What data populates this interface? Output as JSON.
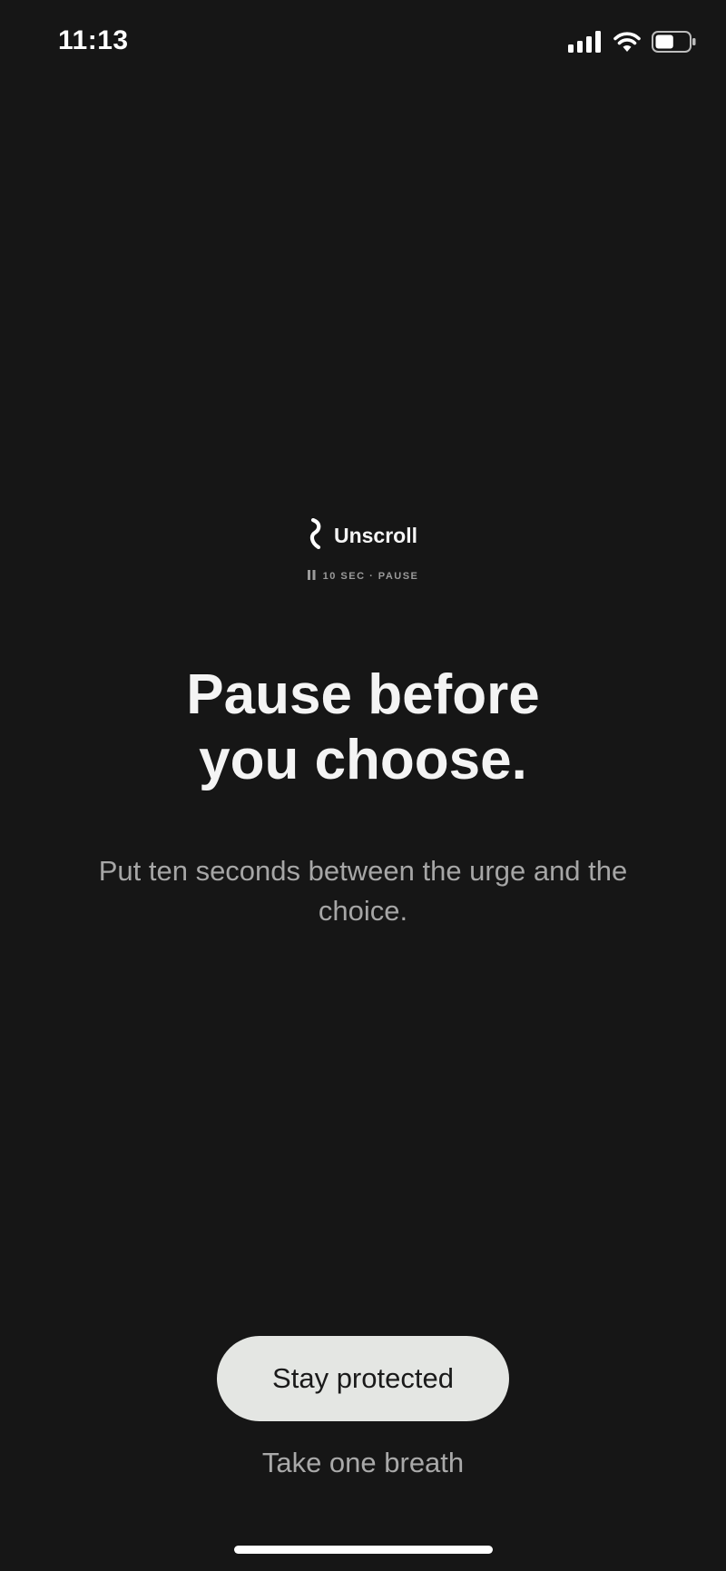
{
  "status_bar": {
    "time": "11:13",
    "icons": [
      "cellular-signal-icon",
      "wifi-icon",
      "battery-icon"
    ],
    "battery_level": 0.55
  },
  "brand": {
    "name": "Unscroll",
    "logo_icon": "unscroll-logo-icon"
  },
  "mode": {
    "icon": "pause-icon",
    "label": "10 SEC · PAUSE"
  },
  "headline": {
    "line1": "Pause before",
    "line2": "you choose."
  },
  "subtext": "Put ten seconds between the urge and the choice.",
  "actions": {
    "primary_label": "Stay protected",
    "secondary_label": "Take one breath"
  },
  "colors": {
    "background": "#161616",
    "primary_button_bg": "#e4e6e3",
    "primary_text": "#f4f4f4",
    "secondary_text": "#a6a6a6"
  }
}
